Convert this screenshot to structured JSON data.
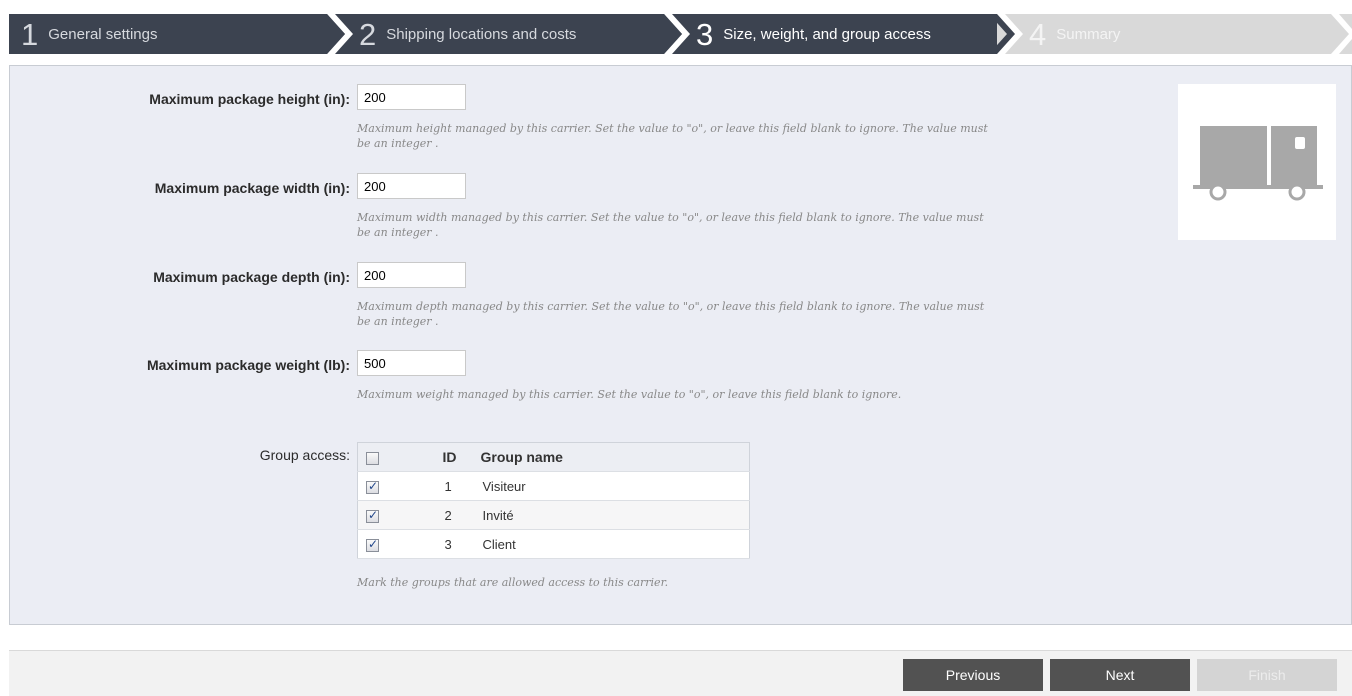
{
  "wizard": {
    "steps": [
      {
        "number": "1",
        "label": "General settings"
      },
      {
        "number": "2",
        "label": "Shipping locations and costs"
      },
      {
        "number": "3",
        "label": "Size, weight, and group access"
      },
      {
        "number": "4",
        "label": "Summary"
      }
    ],
    "active_step": 3
  },
  "form": {
    "height": {
      "label": "Maximum package height (in):",
      "value": "200",
      "help": "Maximum height managed by this carrier. Set the value to \"o\", or leave this field blank to ignore. The value must be an integer ."
    },
    "width": {
      "label": "Maximum package width (in):",
      "value": "200",
      "help": "Maximum width managed by this carrier. Set the value to \"o\", or leave this field blank to ignore. The value must be an integer ."
    },
    "depth": {
      "label": "Maximum package depth (in):",
      "value": "200",
      "help": "Maximum depth managed by this carrier. Set the value to \"o\", or leave this field blank to ignore. The value must be an integer ."
    },
    "weight": {
      "label": "Maximum package weight (lb):",
      "value": "500",
      "help": "Maximum weight managed by this carrier. Set the value to \"o\", or leave this field blank to ignore."
    },
    "group_access": {
      "label": "Group access:",
      "columns": {
        "id": "ID",
        "name": "Group name"
      },
      "select_all_checked": false,
      "rows": [
        {
          "id": "1",
          "name": "Visiteur",
          "checked": true
        },
        {
          "id": "2",
          "name": "Invité",
          "checked": true
        },
        {
          "id": "3",
          "name": "Client",
          "checked": true
        }
      ],
      "help": "Mark the groups that are allowed access to this carrier."
    }
  },
  "logo": {
    "icon": "truck-icon"
  },
  "footer": {
    "previous_label": "Previous",
    "next_label": "Next",
    "finish_label": "Finish"
  },
  "colors": {
    "step_active_bg": "#3c4350",
    "step_todo_bg": "#d9d9d9",
    "panel_bg": "#ebedf4",
    "button_dark": "#525252",
    "button_disabled": "#d4d4d4"
  }
}
